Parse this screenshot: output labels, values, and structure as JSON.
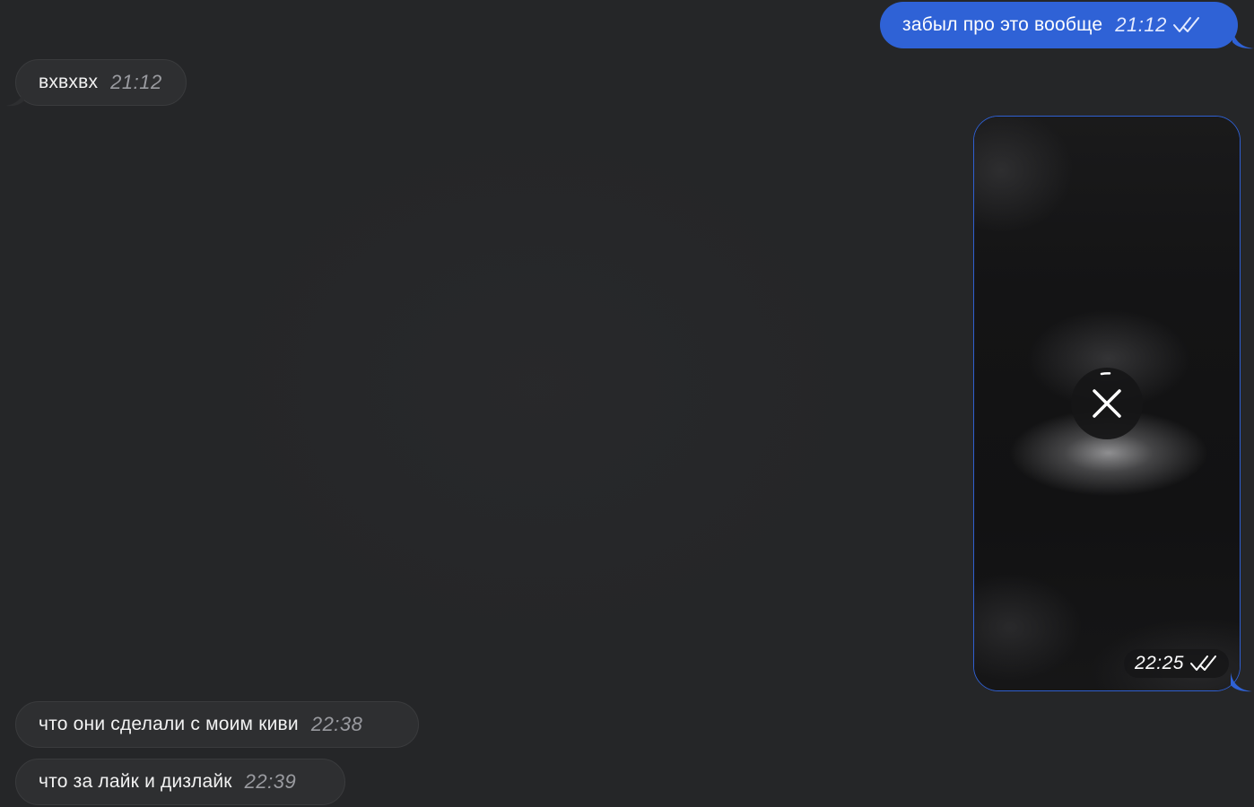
{
  "colors": {
    "background": "#252628",
    "incoming_bubble": "#2e2f31",
    "outgoing_bubble": "#2f62d6"
  },
  "messages": [
    {
      "direction": "outgoing",
      "text": "забыл про это вообще",
      "time": "21:12",
      "status": "double-check-icon"
    },
    {
      "direction": "incoming",
      "text": "вхвхвх",
      "time": "21:12"
    },
    {
      "direction": "outgoing",
      "type": "video",
      "time": "22:25",
      "status": "double-check-icon",
      "overlay_icon": "cancel-upload-icon"
    },
    {
      "direction": "incoming",
      "text": "что они сделали с моим киви",
      "time": "22:38"
    },
    {
      "direction": "incoming",
      "text": "что за лайк и дизлайк",
      "time": "22:39"
    }
  ]
}
